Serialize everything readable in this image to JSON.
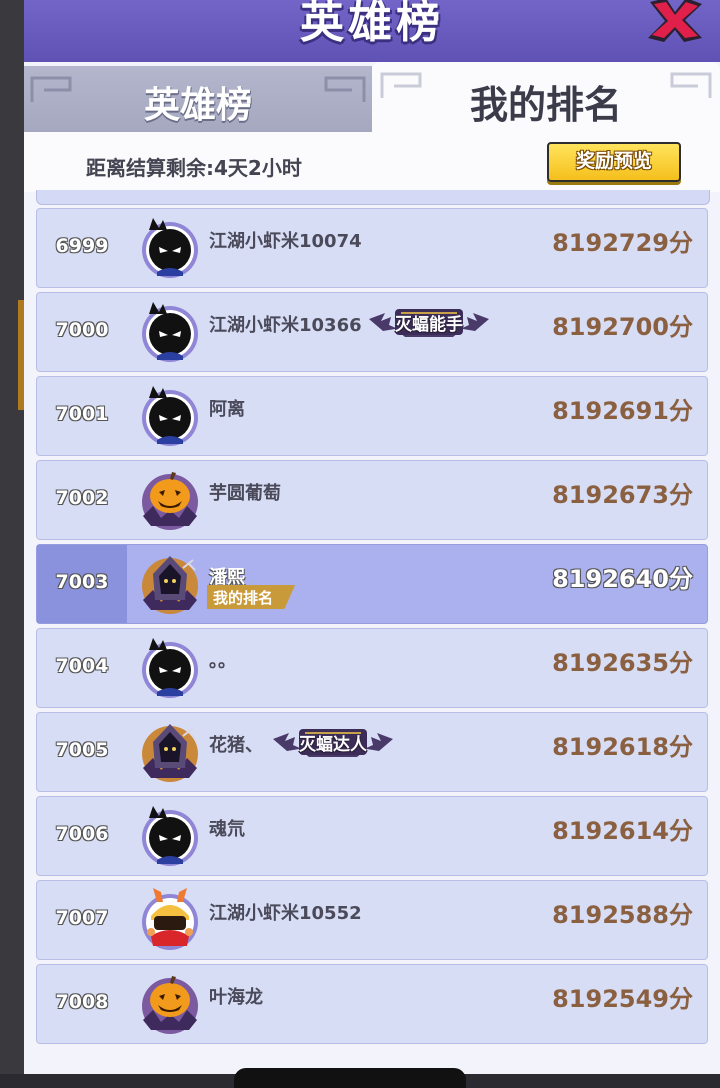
{
  "header": {
    "title": "英雄榜"
  },
  "tabs": {
    "leaderboard": "英雄榜",
    "my_rank": "我的排名"
  },
  "info": {
    "countdown": "距离结算剩余:4天2小时",
    "reward_preview": "奖励预览"
  },
  "rows": [
    {
      "rank": "6999",
      "name": "江湖小虾米10074",
      "score": "8192729分",
      "avatar": "shadow-hero-icon"
    },
    {
      "rank": "7000",
      "name": "江湖小虾米10366",
      "score": "8192700分",
      "avatar": "shadow-hero-icon",
      "badge": "灭蝠能手"
    },
    {
      "rank": "7001",
      "name": "阿离",
      "score": "8192691分",
      "avatar": "shadow-hero-icon"
    },
    {
      "rank": "7002",
      "name": "芋圆葡萄",
      "score": "8192673分",
      "avatar": "pumpkin-icon"
    },
    {
      "rank": "7003",
      "name": "潘熙",
      "score": "8192640分",
      "avatar": "hooded-reaper-icon",
      "tag": "我的排名"
    },
    {
      "rank": "7004",
      "name": "。。",
      "score": "8192635分",
      "avatar": "shadow-hero-icon"
    },
    {
      "rank": "7005",
      "name": "花猪、",
      "score": "8192618分",
      "avatar": "hooded-reaper-icon",
      "badge": "灭蝠达人"
    },
    {
      "rank": "7006",
      "name": "魂氘",
      "score": "8192614分",
      "avatar": "shadow-hero-icon"
    },
    {
      "rank": "7007",
      "name": "江湖小虾米10552",
      "score": "8192588分",
      "avatar": "bunny-warrior-icon"
    },
    {
      "rank": "7008",
      "name": "叶海龙",
      "score": "8192549分",
      "avatar": "pumpkin-icon"
    }
  ]
}
